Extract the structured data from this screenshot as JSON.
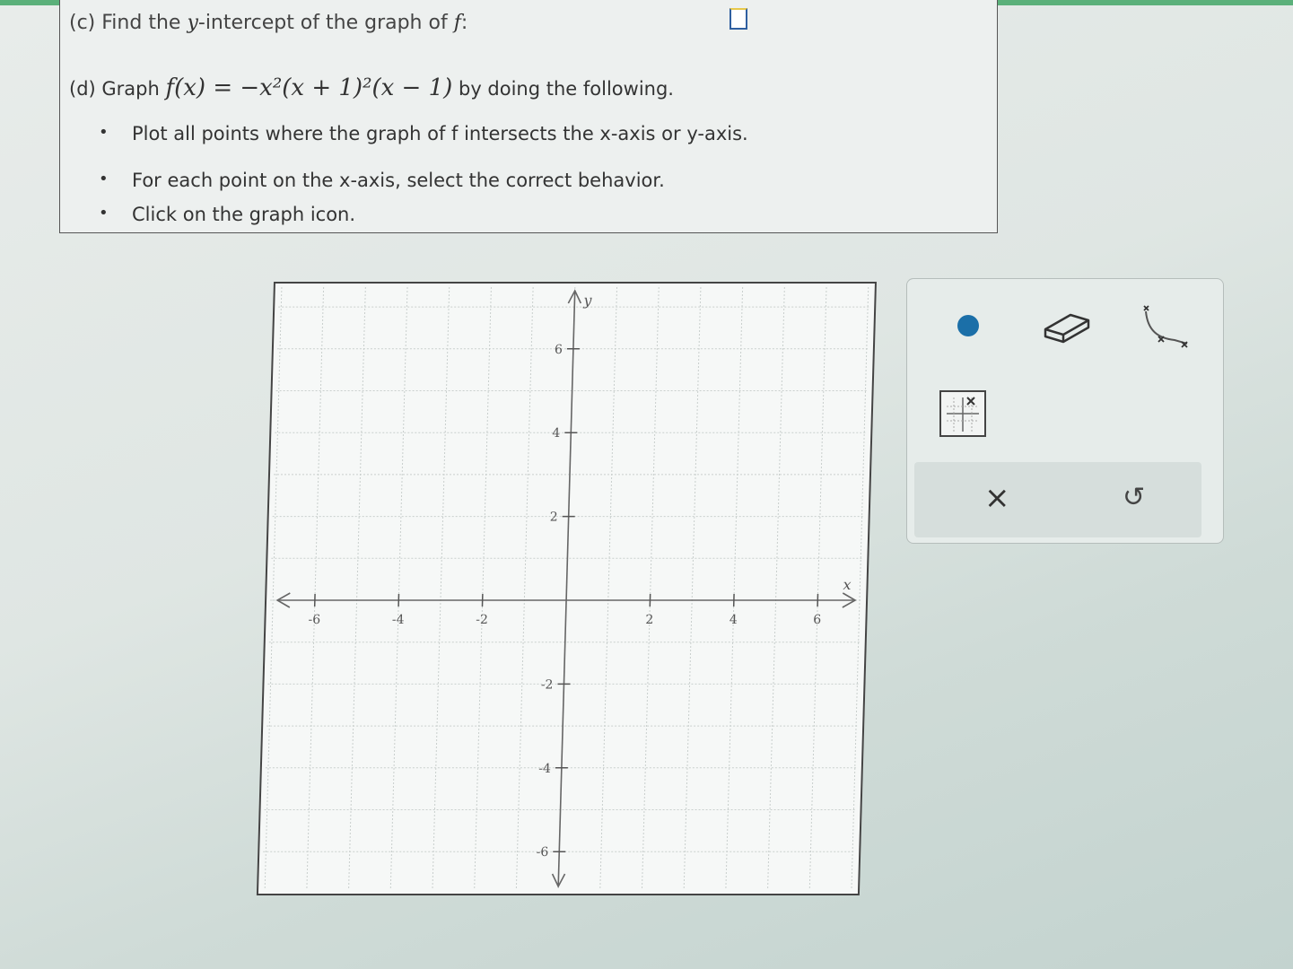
{
  "question": {
    "part_c_label": "(c) Find the",
    "part_c_var": "y",
    "part_c_rest": "-intercept of the graph of",
    "part_c_func": "f",
    "part_c_colon": ":",
    "part_d_label": "(d) Graph",
    "part_d_func": "f(x) = −x²(x + 1)²(x − 1)",
    "part_d_rest": "by doing the following.",
    "bullets": [
      "Plot all points where the graph of f intersects the x-axis or y-axis.",
      "For each point on the x-axis, select the correct behavior.",
      "Click on the graph icon."
    ]
  },
  "graph": {
    "x_label": "x",
    "y_label": "y",
    "x_ticks": [
      "-6",
      "-4",
      "-2",
      "2",
      "4",
      "6"
    ],
    "y_ticks": [
      "6",
      "4",
      "2",
      "-2",
      "-4",
      "-6"
    ]
  },
  "tools": {
    "point_tool": "point-icon",
    "eraser_tool": "eraser-icon",
    "behavior_tool": "curve-behavior-icon",
    "graph_icon": "graph-icon",
    "clear_label": "×",
    "undo_label": "↺"
  },
  "colors": {
    "accent": "#1b6fa8",
    "top_bar": "#5bb07a"
  }
}
